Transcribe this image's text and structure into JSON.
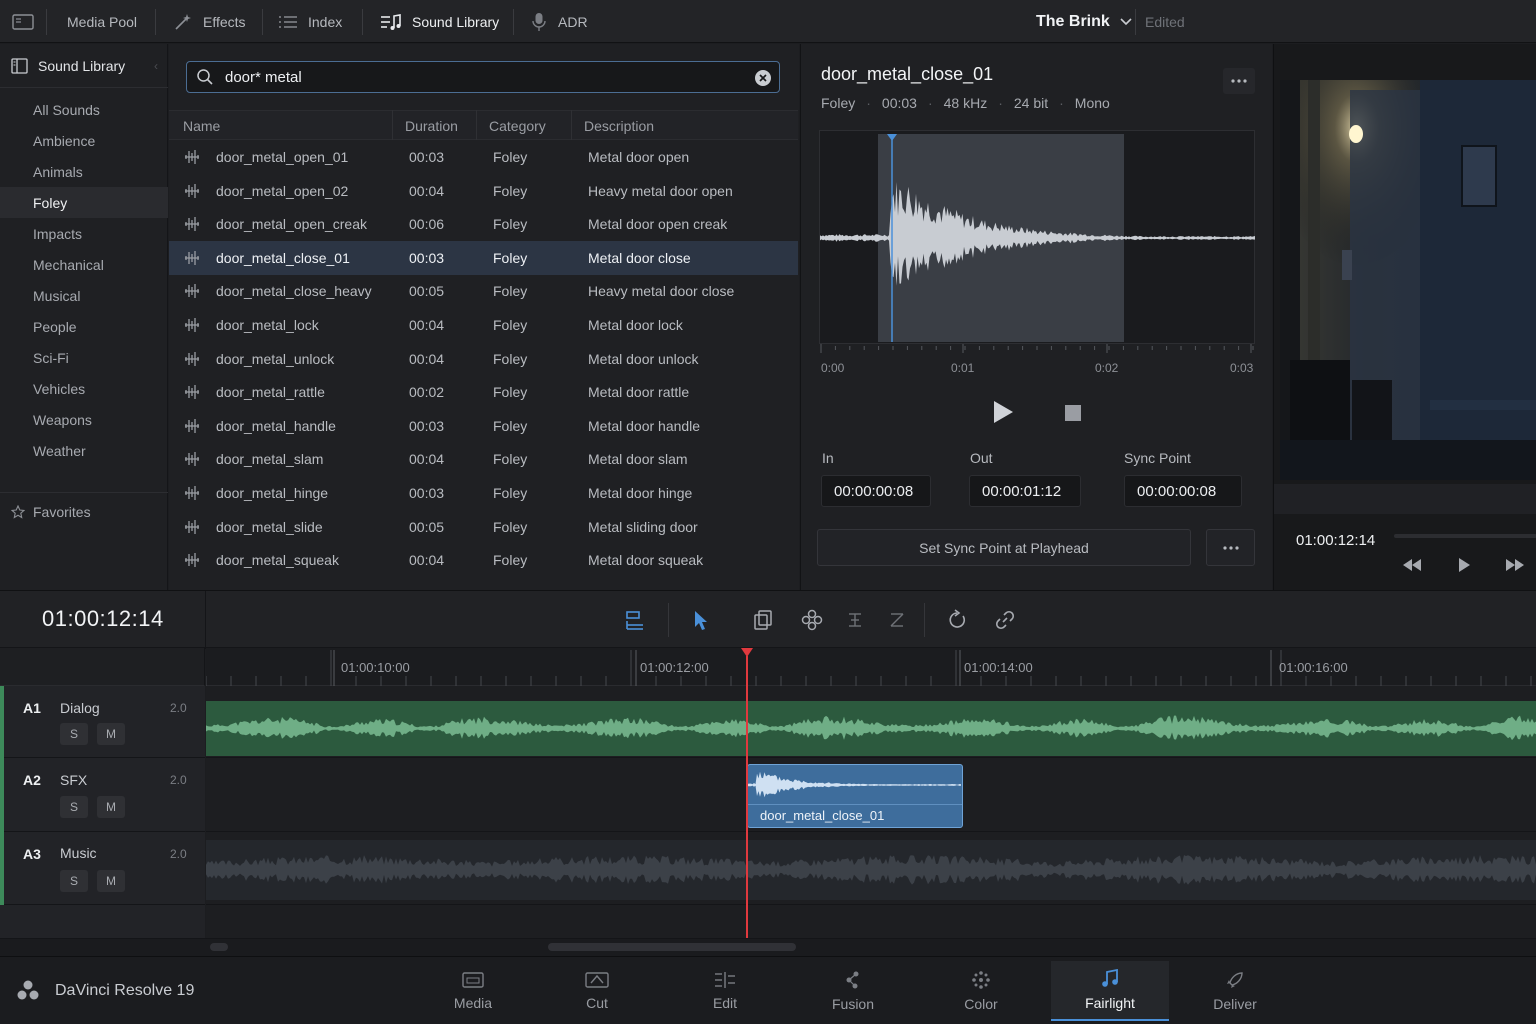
{
  "topbar": {
    "items": [
      {
        "label": "Media Pool"
      },
      {
        "label": "Effects"
      },
      {
        "label": "Index"
      },
      {
        "label": "Sound Library"
      },
      {
        "label": "ADR"
      }
    ],
    "project_title": "The Brink",
    "project_status": "Edited"
  },
  "sidebar": {
    "header": "Sound Library",
    "items": [
      "All Sounds",
      "Ambience",
      "Animals",
      "Foley",
      "Impacts",
      "Mechanical",
      "Musical",
      "People",
      "Sci-Fi",
      "Vehicles",
      "Weapons",
      "Weather"
    ],
    "selected": "Foley",
    "favorites": "Favorites"
  },
  "search": {
    "value": "door* metal"
  },
  "columns": [
    "Name",
    "Duration",
    "Category",
    "Description"
  ],
  "rows": [
    {
      "name": "door_metal_open_01",
      "duration": "00:03",
      "category": "Foley",
      "description": "Metal door open"
    },
    {
      "name": "door_metal_open_02",
      "duration": "00:04",
      "category": "Foley",
      "description": "Heavy metal door open"
    },
    {
      "name": "door_metal_open_creak",
      "duration": "00:06",
      "category": "Foley",
      "description": "Metal door open creak"
    },
    {
      "name": "door_metal_close_01",
      "duration": "00:03",
      "category": "Foley",
      "description": "Metal door close"
    },
    {
      "name": "door_metal_close_heavy",
      "duration": "00:05",
      "category": "Foley",
      "description": "Heavy metal door close"
    },
    {
      "name": "door_metal_lock",
      "duration": "00:04",
      "category": "Foley",
      "description": "Metal door lock"
    },
    {
      "name": "door_metal_unlock",
      "duration": "00:04",
      "category": "Foley",
      "description": "Metal door unlock"
    },
    {
      "name": "door_metal_rattle",
      "duration": "00:02",
      "category": "Foley",
      "description": "Metal door rattle"
    },
    {
      "name": "door_metal_handle",
      "duration": "00:03",
      "category": "Foley",
      "description": "Metal door handle"
    },
    {
      "name": "door_metal_slam",
      "duration": "00:04",
      "category": "Foley",
      "description": "Metal door slam"
    },
    {
      "name": "door_metal_hinge",
      "duration": "00:03",
      "category": "Foley",
      "description": "Metal door hinge"
    },
    {
      "name": "door_metal_slide",
      "duration": "00:05",
      "category": "Foley",
      "description": "Metal sliding door"
    },
    {
      "name": "door_metal_squeak",
      "duration": "00:04",
      "category": "Foley",
      "description": "Metal door squeak"
    }
  ],
  "detail": {
    "title": "door_metal_close_01",
    "meta": [
      "Foley",
      "00:03",
      "48 kHz",
      "24 bit",
      "Mono"
    ],
    "ticks": [
      "0:00",
      "0:01",
      "0:02",
      "0:03"
    ],
    "in_label": "In",
    "in_value": "00:00:00:08",
    "out_label": "Out",
    "out_value": "00:00:01:12",
    "sync_label": "Sync Point",
    "sync_value": "00:00:00:08",
    "sync_button": "Set Sync Point at Playhead"
  },
  "viewer": {
    "timecode": "01:00:12:14"
  },
  "timeline": {
    "timecode": "01:00:12:14",
    "ruler": [
      "01:00:10:00",
      "01:00:12:00",
      "01:00:14:00",
      "01:00:16:00"
    ],
    "tracks": [
      {
        "id": "A1",
        "name": "Dialog",
        "format": "2.0"
      },
      {
        "id": "A2",
        "name": "SFX",
        "format": "2.0"
      },
      {
        "id": "A3",
        "name": "Music",
        "format": "2.0"
      }
    ],
    "solo_label": "S",
    "mute_label": "M",
    "clip_name": "door_metal_close_01"
  },
  "bottombar": {
    "app_name": "DaVinci Resolve 19",
    "pages": [
      "Media",
      "Cut",
      "Edit",
      "Fusion",
      "Color",
      "Fairlight",
      "Deliver"
    ],
    "active_page": "Fairlight"
  },
  "colors": {
    "accent": "#4a90d9",
    "playhead": "#e0393e",
    "dialog_wave": "#5f9e78",
    "sfx_clip": "#3e6d9c"
  }
}
